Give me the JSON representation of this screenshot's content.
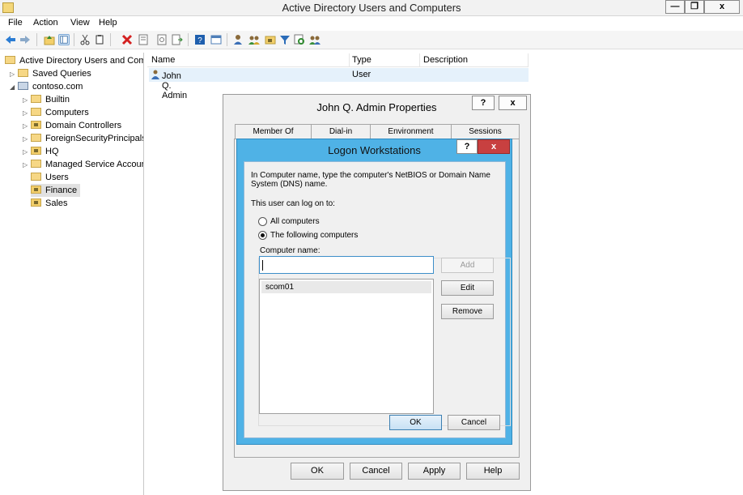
{
  "window": {
    "title": "Active Directory Users and Computers",
    "minimize": "—",
    "restore": "❐",
    "close": "x"
  },
  "menu": [
    "File",
    "Action",
    "View",
    "Help"
  ],
  "tree": {
    "root": "Active Directory Users and Com",
    "saved_queries": "Saved Queries",
    "domain": "contoso.com",
    "children": [
      "Builtin",
      "Computers",
      "Domain Controllers",
      "ForeignSecurityPrincipals",
      "HQ",
      "Managed Service Accour",
      "Users",
      "Finance",
      "Sales"
    ]
  },
  "list": {
    "columns": [
      "Name",
      "Type",
      "Description"
    ],
    "rows": [
      {
        "name": "John Q. Admin",
        "type": "User",
        "description": ""
      }
    ]
  },
  "properties_dialog": {
    "title": "John Q. Admin Properties",
    "help_btn": "?",
    "close_btn": "x",
    "tabs": [
      "Member Of",
      "Dial-in",
      "Environment",
      "Sessions"
    ],
    "buttons": {
      "ok": "OK",
      "cancel": "Cancel",
      "apply": "Apply",
      "help": "Help"
    }
  },
  "logon_dialog": {
    "title": "Logon Workstations",
    "help_btn": "?",
    "close_btn": "x",
    "instructions": "In Computer name, type the computer's NetBIOS or Domain Name System (DNS) name.",
    "can_logon_label": "This user can log on to:",
    "radio_all": "All computers",
    "radio_following": "The following computers",
    "selected_option": "The following computers",
    "computer_name_label": "Computer name:",
    "computer_name_value": "",
    "workstations": [
      "scom01"
    ],
    "buttons": {
      "add": "Add",
      "edit": "Edit",
      "remove": "Remove",
      "ok": "OK",
      "cancel": "Cancel"
    }
  }
}
